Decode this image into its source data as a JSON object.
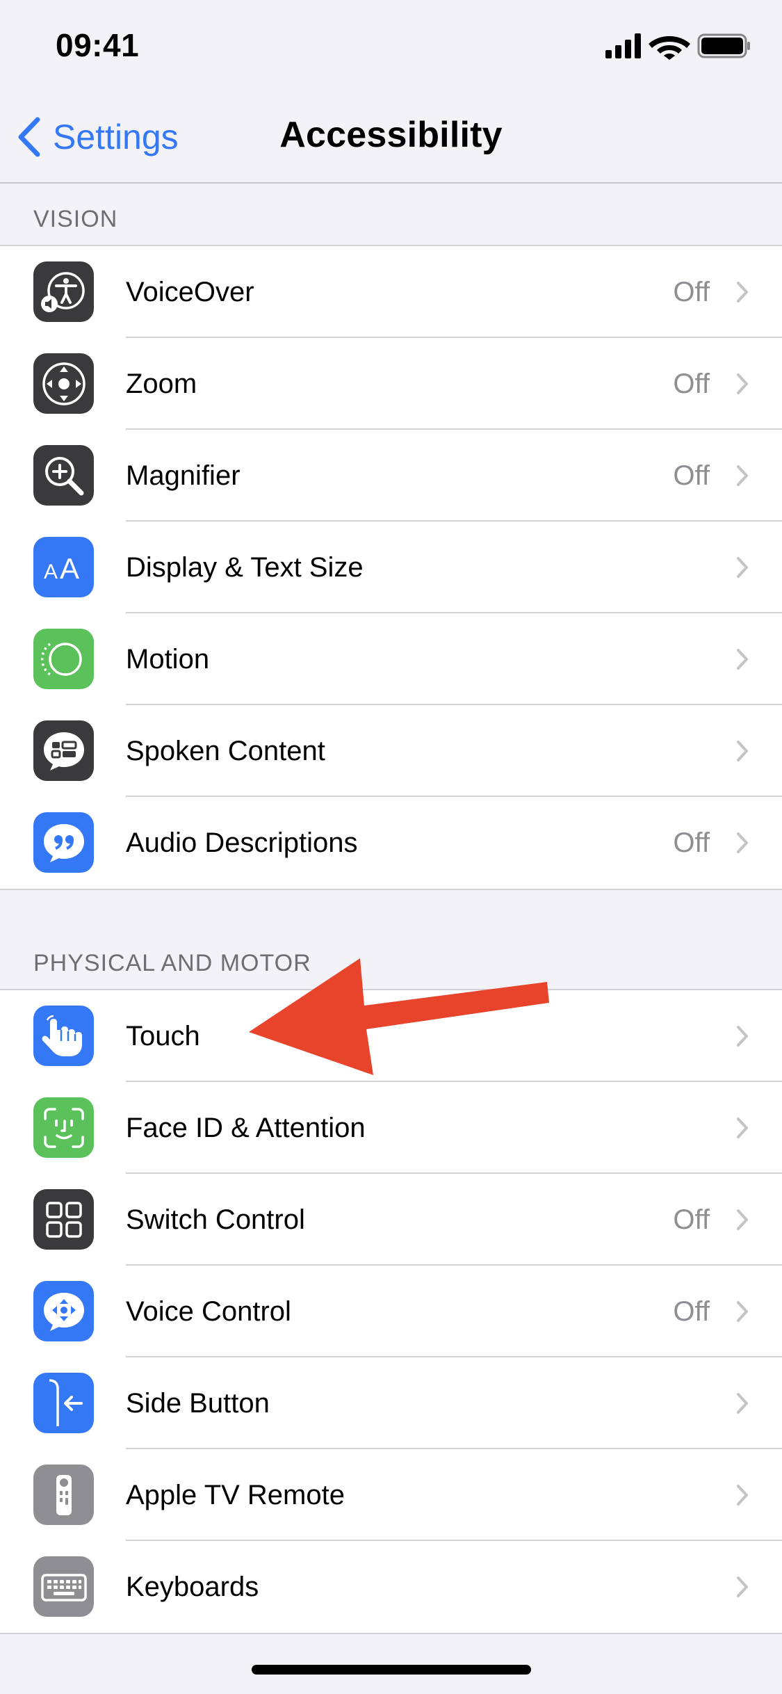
{
  "status_bar": {
    "time": "09:41"
  },
  "nav": {
    "back_label": "Settings",
    "title": "Accessibility"
  },
  "sections": [
    {
      "header": "VISION",
      "rows": [
        {
          "label": "VoiceOver",
          "value": "Off",
          "icon": "voiceover-icon",
          "color": "#3a3a3c"
        },
        {
          "label": "Zoom",
          "value": "Off",
          "icon": "zoom-icon",
          "color": "#3a3a3c"
        },
        {
          "label": "Magnifier",
          "value": "Off",
          "icon": "magnifier-icon",
          "color": "#3a3a3c"
        },
        {
          "label": "Display & Text Size",
          "value": "",
          "icon": "text-size-icon",
          "color": "#3478f6"
        },
        {
          "label": "Motion",
          "value": "",
          "icon": "motion-icon",
          "color": "#5ac15b"
        },
        {
          "label": "Spoken Content",
          "value": "",
          "icon": "spoken-content-icon",
          "color": "#3a3a3c"
        },
        {
          "label": "Audio Descriptions",
          "value": "Off",
          "icon": "audio-descriptions-icon",
          "color": "#3478f6"
        }
      ]
    },
    {
      "header": "PHYSICAL AND MOTOR",
      "rows": [
        {
          "label": "Touch",
          "value": "",
          "icon": "touch-hand-icon",
          "color": "#3478f6"
        },
        {
          "label": "Face ID & Attention",
          "value": "",
          "icon": "face-id-icon",
          "color": "#5ac15b"
        },
        {
          "label": "Switch Control",
          "value": "Off",
          "icon": "switch-control-icon",
          "color": "#3a3a3c"
        },
        {
          "label": "Voice Control",
          "value": "Off",
          "icon": "voice-control-icon",
          "color": "#3478f6"
        },
        {
          "label": "Side Button",
          "value": "",
          "icon": "side-button-icon",
          "color": "#3478f6"
        },
        {
          "label": "Apple TV Remote",
          "value": "",
          "icon": "tv-remote-icon",
          "color": "#8e8e93"
        },
        {
          "label": "Keyboards",
          "value": "",
          "icon": "keyboard-icon",
          "color": "#8e8e93"
        }
      ]
    }
  ],
  "colors": {
    "accent": "#3478f6",
    "annotation_arrow": "#e8442c"
  }
}
